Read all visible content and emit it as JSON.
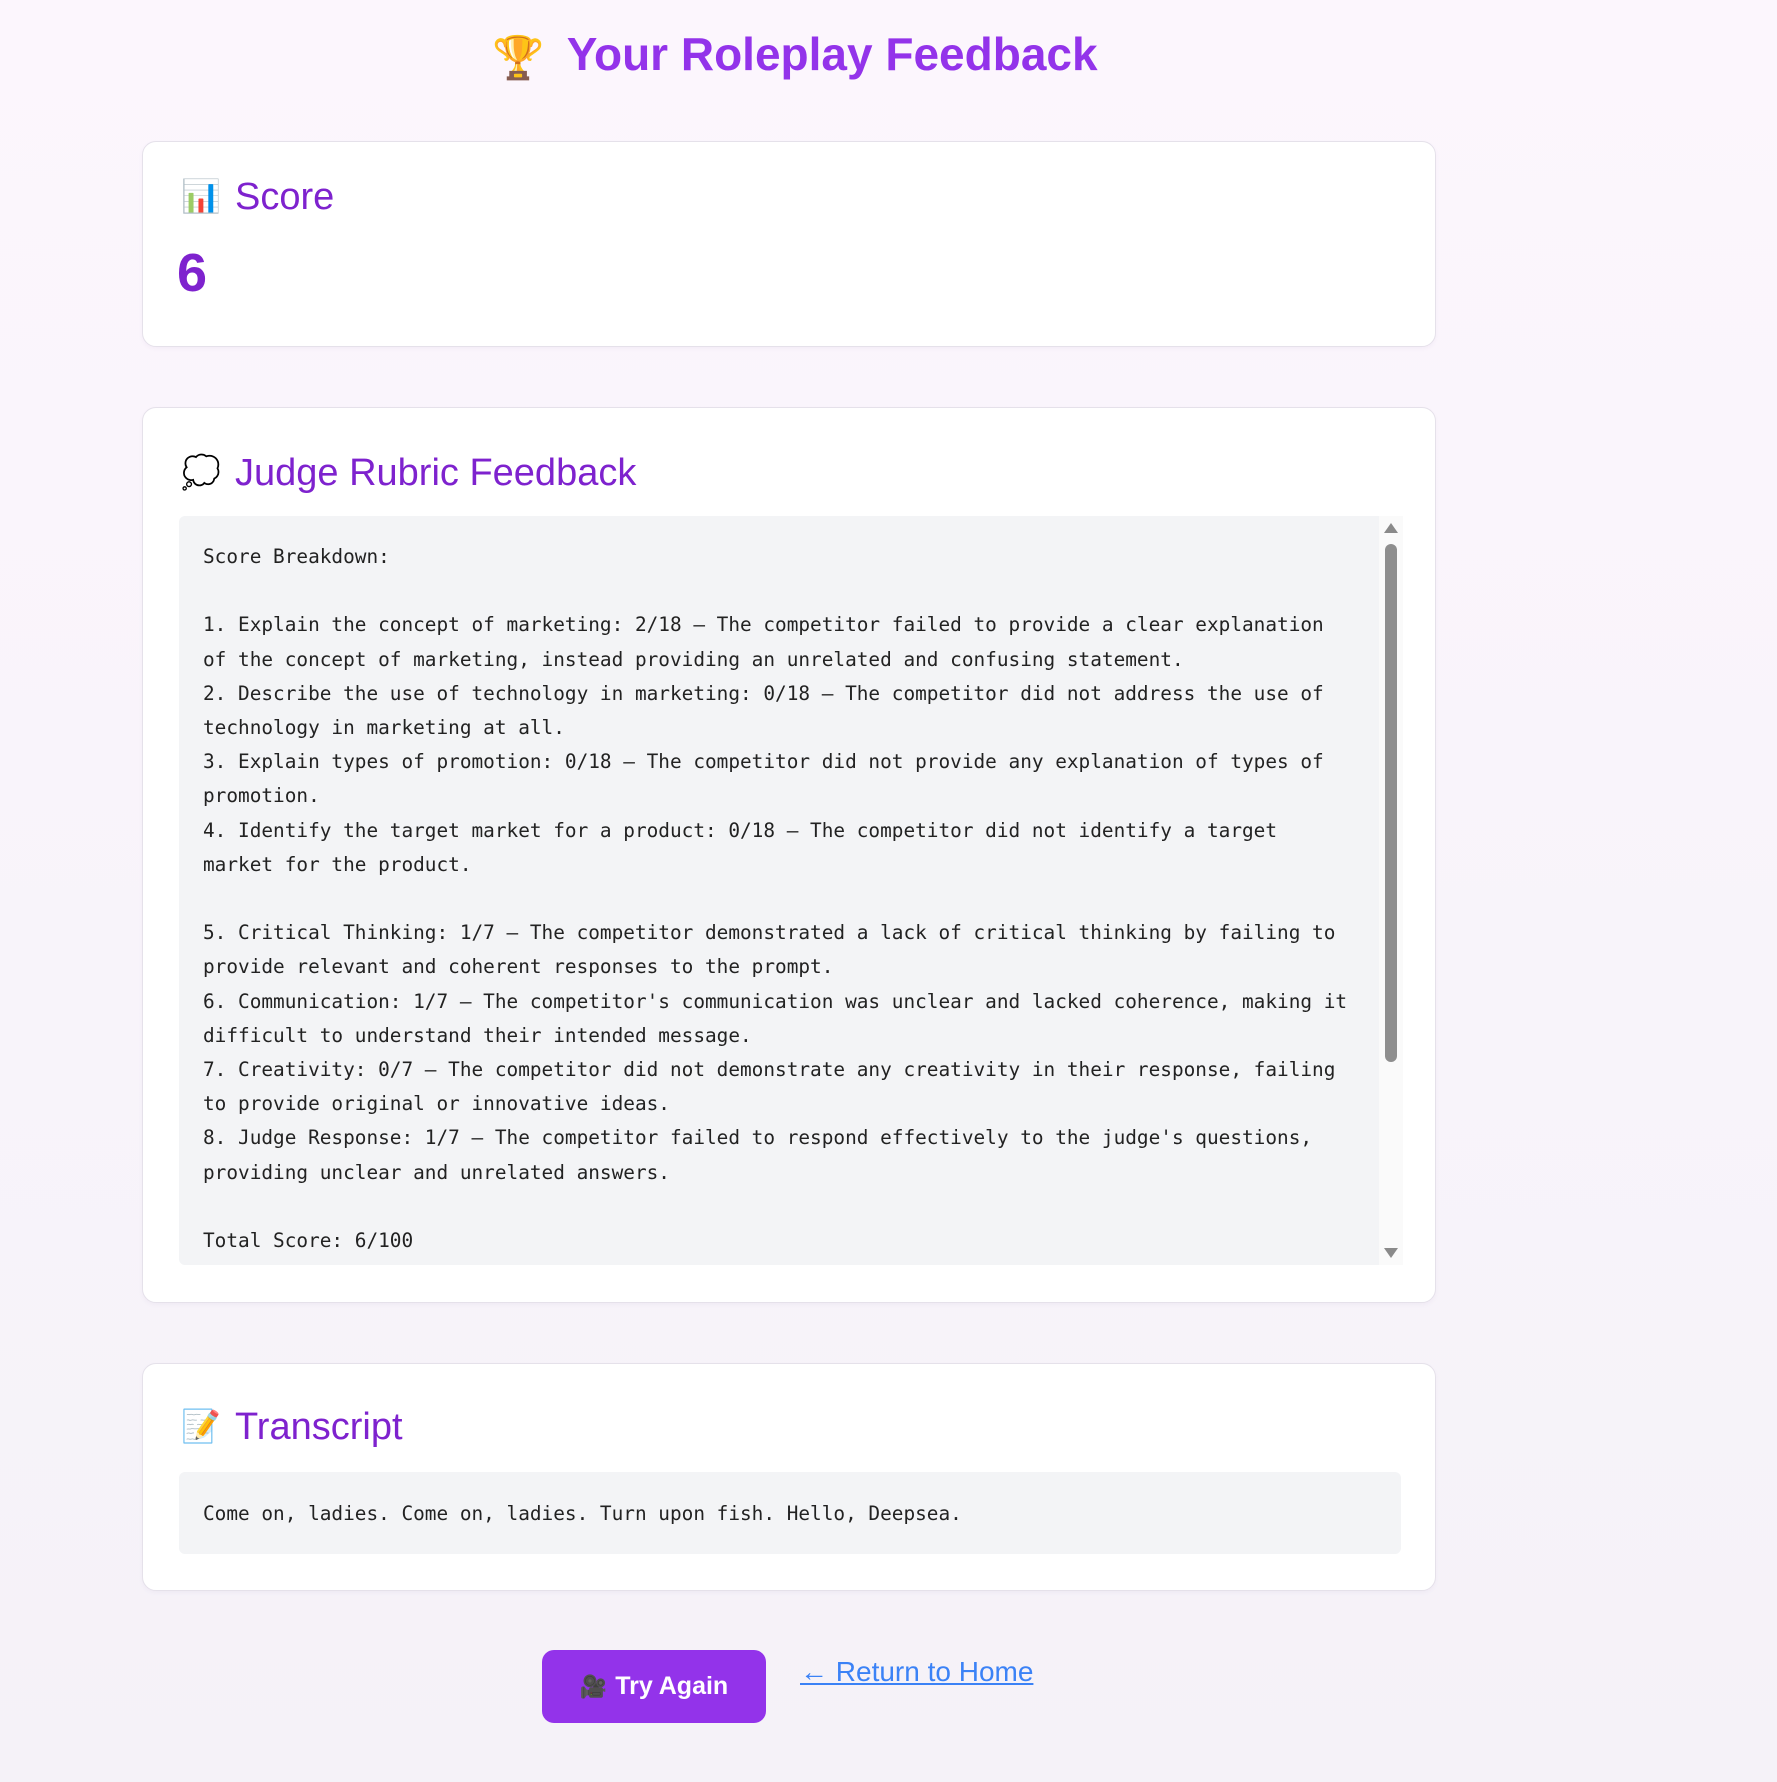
{
  "header": {
    "title": "Your Roleplay Feedback",
    "icon": "trophy-icon",
    "icon_glyph": "🏆"
  },
  "score_card": {
    "heading": "Score",
    "icon": "bar-chart-icon",
    "icon_glyph": "📊",
    "value": "6"
  },
  "feedback_card": {
    "heading": "Judge Rubric Feedback",
    "icon": "speech-bubble-icon",
    "icon_glyph": "💭",
    "text": "Score Breakdown:\n\n1. Explain the concept of marketing: 2/18 – The competitor failed to provide a clear explanation of the concept of marketing, instead providing an unrelated and confusing statement.\n2. Describe the use of technology in marketing: 0/18 – The competitor did not address the use of technology in marketing at all.\n3. Explain types of promotion: 0/18 – The competitor did not provide any explanation of types of promotion.\n4. Identify the target market for a product: 0/18 – The competitor did not identify a target market for the product.\n\n5. Critical Thinking: 1/7 – The competitor demonstrated a lack of critical thinking by failing to provide relevant and coherent responses to the prompt.\n6. Communication: 1/7 – The competitor's communication was unclear and lacked coherence, making it difficult to understand their intended message.\n7. Creativity: 0/7 – The competitor did not demonstrate any creativity in their response, failing to provide original or innovative ideas.\n8. Judge Response: 1/7 – The competitor failed to respond effectively to the judge's questions, providing unclear and unrelated answers.\n\nTotal Score: 6/100"
  },
  "transcript_card": {
    "heading": "Transcript",
    "icon": "memo-icon",
    "icon_glyph": "📝",
    "text": "Come on, ladies. Come on, ladies. Turn upon fish. Hello, Deepsea."
  },
  "actions": {
    "try_again_label": "Try Again",
    "try_again_icon": "movie-camera-icon",
    "try_again_glyph": "🎥",
    "return_label": "← Return to Home"
  },
  "colors": {
    "accent": "#9333ea",
    "heading": "#7e22ce",
    "link": "#3b82f6"
  }
}
